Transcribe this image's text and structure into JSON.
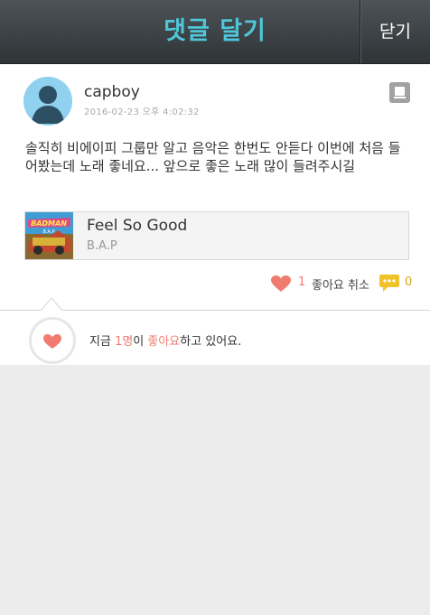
{
  "header": {
    "title": "댓글 달기",
    "close_label": "닫기"
  },
  "comment": {
    "author": "capboy",
    "timestamp": "2016-02-23 오후 4:02:32",
    "text": "솔직히 비에이피 그룹만 알고 음악은 한번도 안듣다 이번에 처음 들어봤는데 노래 좋네요... 앞으로 좋은 노래 많이 들려주시길",
    "song": {
      "title": "Feel So Good",
      "artist": "B.A.P",
      "album_art_text": "B.A.P"
    },
    "like_count": "1",
    "unlike_label": "좋아요 취소",
    "comment_count": "0"
  },
  "likes": {
    "prefix": "지금 ",
    "count_text": "1명",
    "middle": "이 ",
    "like_word": "좋아요",
    "suffix": "하고 있어요."
  },
  "colors": {
    "accent": "#f07b6e",
    "title": "#4fc6d9",
    "comment_icon": "#f2c22a"
  }
}
